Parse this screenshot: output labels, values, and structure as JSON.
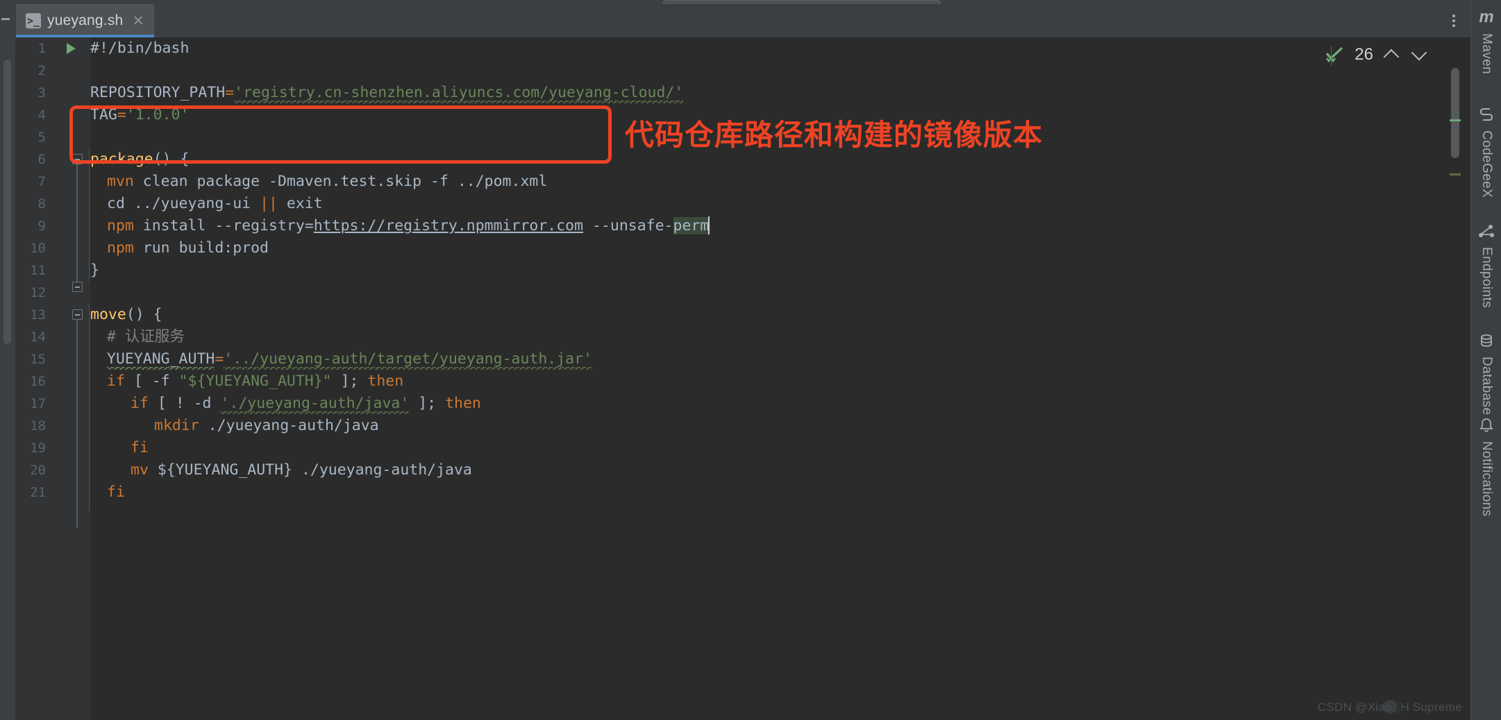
{
  "window": {
    "title": "yueyang.sh",
    "theme_bg": "#2b2b2b",
    "accent": "#4a88c7",
    "annotation_color": "#ef4323"
  },
  "tab": {
    "label": "yueyang.sh",
    "icon": "shell-script-icon",
    "icon_glyph": ">_",
    "close_glyph": "✕",
    "kebab_name": "tab-options-kebab"
  },
  "inspection": {
    "status_icon": "inspection-ok-check-icon",
    "count": "26",
    "prev_label": "⌃",
    "next_label": "⌄"
  },
  "annotation": {
    "text": "代码仓库路径和构建的镜像版本",
    "box_name": "red-highlight-box"
  },
  "editor": {
    "language": "bash",
    "caret_line": 9,
    "selection": "perm",
    "lines": [
      {
        "n": "1",
        "has_run": true,
        "fold": "",
        "indent": 0
      },
      {
        "n": "2",
        "has_run": false,
        "fold": "",
        "indent": 0
      },
      {
        "n": "3",
        "has_run": false,
        "fold": "",
        "indent": 0
      },
      {
        "n": "4",
        "has_run": false,
        "fold": "",
        "indent": 0
      },
      {
        "n": "5",
        "has_run": false,
        "fold": "",
        "indent": 0
      },
      {
        "n": "6",
        "has_run": false,
        "fold": "open",
        "indent": 0
      },
      {
        "n": "7",
        "has_run": false,
        "fold": "",
        "indent": 1
      },
      {
        "n": "8",
        "has_run": false,
        "fold": "",
        "indent": 1
      },
      {
        "n": "9",
        "has_run": false,
        "fold": "",
        "indent": 1
      },
      {
        "n": "10",
        "has_run": false,
        "fold": "",
        "indent": 1
      },
      {
        "n": "11",
        "has_run": false,
        "fold": "close",
        "indent": 0
      },
      {
        "n": "12",
        "has_run": false,
        "fold": "",
        "indent": 0
      },
      {
        "n": "13",
        "has_run": false,
        "fold": "open",
        "indent": 0
      },
      {
        "n": "14",
        "has_run": false,
        "fold": "",
        "indent": 1
      },
      {
        "n": "15",
        "has_run": false,
        "fold": "",
        "indent": 1
      },
      {
        "n": "16",
        "has_run": false,
        "fold": "",
        "indent": 1
      },
      {
        "n": "17",
        "has_run": false,
        "fold": "",
        "indent": 2
      },
      {
        "n": "18",
        "has_run": false,
        "fold": "",
        "indent": 3
      },
      {
        "n": "19",
        "has_run": false,
        "fold": "",
        "indent": 2
      },
      {
        "n": "20",
        "has_run": false,
        "fold": "",
        "indent": 2
      },
      {
        "n": "21",
        "has_run": false,
        "fold": "",
        "indent": 1
      }
    ],
    "code": {
      "l1": "#!/bin/bash",
      "l3_name": "REPOSITORY_PATH",
      "l3_eq": "=",
      "l3_val": "'registry.cn-shenzhen.aliyuncs.com/yueyang-cloud/'",
      "l4_name": "TAG",
      "l4_eq": "=",
      "l4_val": "'1.0.0'",
      "l6_fn": "package",
      "l6_rest": "() {",
      "l7_cmd": "mvn",
      "l7_rest": " clean package -Dmaven.test.skip -f ../pom.xml",
      "l8_cmd": "cd",
      "l8_arg": " ../yueyang-ui ",
      "l8_op": "||",
      "l8_tail": " exit",
      "l9_cmd": "npm",
      "l9_a": " install --registry=",
      "l9_url": "https://registry.npmmirror.com",
      "l9_b": " --unsafe-",
      "l9_sel": "perm",
      "l10_cmd": "npm",
      "l10_rest": " run build:prod",
      "l11": "}",
      "l13_fn": "move",
      "l13_rest": "() {",
      "l14_cmt": "# 认证服务",
      "l15_name": "YUEYANG_AUTH",
      "l15_eq": "=",
      "l15_val": "'../yueyang-auth/target/yueyang-auth.jar'",
      "l16_if": "if",
      "l16_a": " [ -f ",
      "l16_str": "\"${YUEYANG_AUTH}\"",
      "l16_b": " ]; ",
      "l16_then": "then",
      "l17_if": "if",
      "l17_a": " [ ! -d ",
      "l17_str": "'./yueyang-auth/java'",
      "l17_b": " ]; ",
      "l17_then": "then",
      "l18_cmd": "mkdir",
      "l18_rest": " ./yueyang-auth/java",
      "l19_fi": "fi",
      "l20_cmd": "mv",
      "l20_rest": " ${YUEYANG_AUTH} ./yueyang-auth/java",
      "l21_fi": "fi"
    }
  },
  "right_sidebar": {
    "items": [
      {
        "label": "Maven",
        "icon": "maven-icon",
        "icon_glyph": "m"
      },
      {
        "label": "CodeGeeX",
        "icon": "codegeex-icon",
        "icon_glyph": "↯"
      },
      {
        "label": "Endpoints",
        "icon": "endpoints-icon",
        "icon_glyph": "⁂"
      },
      {
        "label": "Database",
        "icon": "database-icon",
        "icon_glyph": "‖"
      },
      {
        "label": "Notifications",
        "icon": "notifications-icon",
        "icon_glyph": "◎"
      }
    ]
  },
  "watermark": {
    "text": "CSDN @Xiao░H Supreme"
  }
}
